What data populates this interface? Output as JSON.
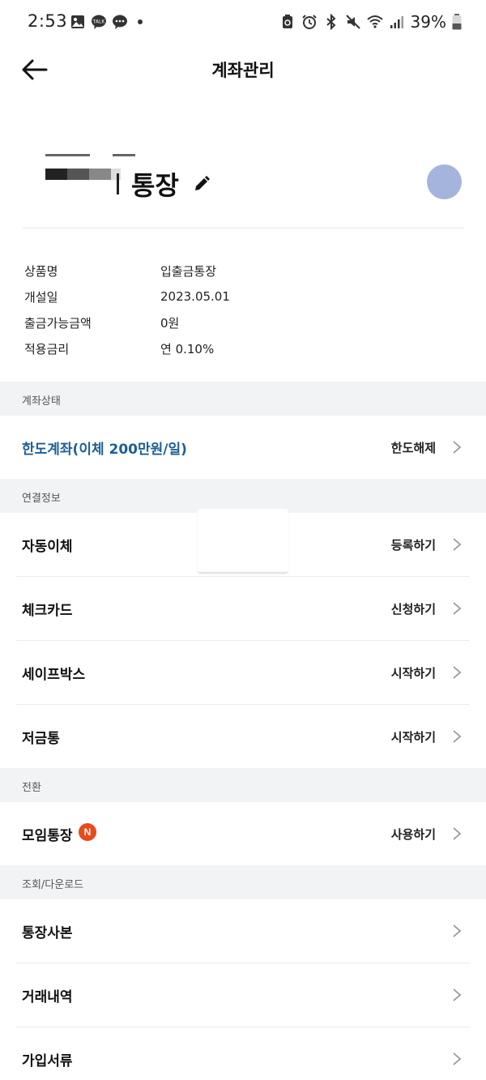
{
  "status_bar": {
    "time": "2:53",
    "battery": "39%",
    "left_icons": [
      "gallery-icon",
      "kakaotalk-icon",
      "chat-icon",
      "dot-icon"
    ],
    "right_icons": [
      "battery-saver-icon",
      "alarm-icon",
      "bluetooth-icon",
      "mute-icon",
      "wifi-icon",
      "signal-icon",
      "battery-icon"
    ]
  },
  "header": {
    "title": "계좌관리",
    "back_icon": "arrow-left-icon"
  },
  "account": {
    "name": "통장",
    "edit_icon": "pencil-icon",
    "avatar_color": "#a4b4dc"
  },
  "info": [
    {
      "label": "상품명",
      "value": "입출금통장"
    },
    {
      "label": "개설일",
      "value": "2023.05.01"
    },
    {
      "label": "출금가능금액",
      "value": "0원"
    },
    {
      "label": "적용금리",
      "value": "연 0.10%"
    }
  ],
  "sections": {
    "status": {
      "title": "계좌상태",
      "items": [
        {
          "label": "한도계좌(이체 200만원/일)",
          "action": "한도해제"
        }
      ]
    },
    "linked": {
      "title": "연결정보",
      "items": [
        {
          "label": "자동이체",
          "action": "등록하기"
        },
        {
          "label": "체크카드",
          "action": "신청하기"
        },
        {
          "label": "세이프박스",
          "action": "시작하기"
        },
        {
          "label": "저금통",
          "action": "시작하기"
        }
      ]
    },
    "convert": {
      "title": "전환",
      "items": [
        {
          "label": "모임통장",
          "badge": "N",
          "action": "사용하기"
        }
      ]
    },
    "inquiry": {
      "title": "조회/다운로드",
      "items": [
        {
          "label": "통장사본"
        },
        {
          "label": "거래내역"
        },
        {
          "label": "가입서류"
        }
      ]
    }
  },
  "colors": {
    "accent_blue": "#1c5f96",
    "badge_orange": "#e84a1c",
    "section_bg": "#f2f3f5"
  }
}
